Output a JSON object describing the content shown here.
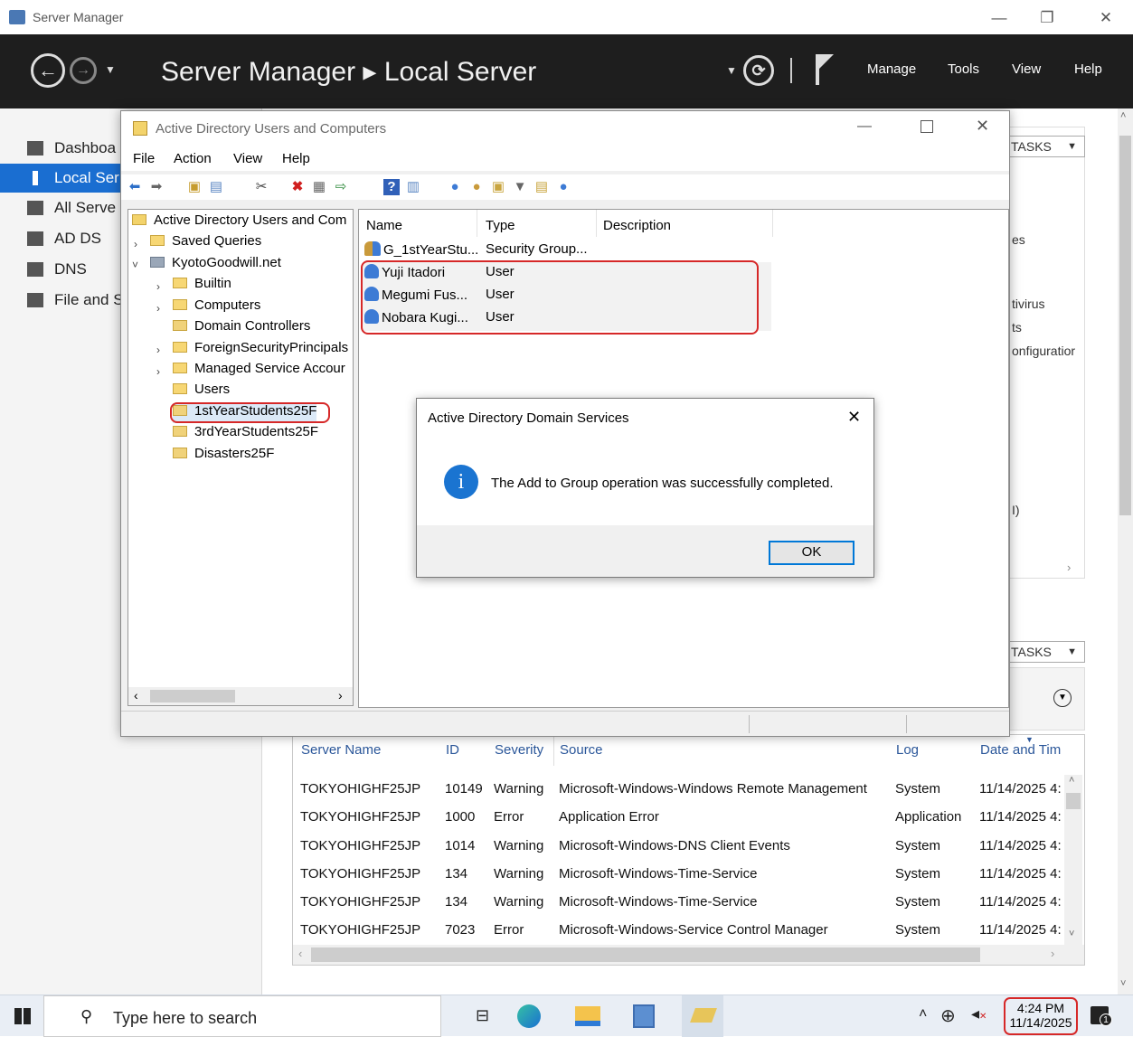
{
  "server_manager": {
    "window_title": "Server Manager",
    "breadcrumb": "Server Manager  ▸  Local Server",
    "menu": [
      "Manage",
      "Tools",
      "View",
      "Help"
    ],
    "nav": [
      {
        "label": "Dashboa",
        "selected": false
      },
      {
        "label": "Local Ser",
        "selected": true
      },
      {
        "label": "All Serve",
        "selected": false
      },
      {
        "label": "AD DS",
        "selected": false
      },
      {
        "label": "DNS",
        "selected": false
      },
      {
        "label": "File and S",
        "selected": false
      }
    ],
    "tasks_label": "TASKS",
    "side_fragments": [
      "es",
      "tivirus",
      "ts",
      "onfiguratior",
      "I)"
    ]
  },
  "events": {
    "columns": [
      "Server Name",
      "ID",
      "Severity",
      "Source",
      "Log",
      "Date and Tim"
    ],
    "rows": [
      [
        "TOKYOHIGHF25JP",
        "10149",
        "Warning",
        "Microsoft-Windows-Windows Remote Management",
        "System",
        "11/14/2025 4:"
      ],
      [
        "TOKYOHIGHF25JP",
        "1000",
        "Error",
        "Application Error",
        "Application",
        "11/14/2025 4:"
      ],
      [
        "TOKYOHIGHF25JP",
        "1014",
        "Warning",
        "Microsoft-Windows-DNS Client Events",
        "System",
        "11/14/2025 4:"
      ],
      [
        "TOKYOHIGHF25JP",
        "134",
        "Warning",
        "Microsoft-Windows-Time-Service",
        "System",
        "11/14/2025 4:"
      ],
      [
        "TOKYOHIGHF25JP",
        "134",
        "Warning",
        "Microsoft-Windows-Time-Service",
        "System",
        "11/14/2025 4:"
      ],
      [
        "TOKYOHIGHF25JP",
        "7023",
        "Error",
        "Microsoft-Windows-Service Control Manager",
        "System",
        "11/14/2025 4:"
      ]
    ]
  },
  "aduc": {
    "title": "Active Directory Users and Computers",
    "menu": [
      "File",
      "Action",
      "View",
      "Help"
    ],
    "tree": {
      "root": "Active Directory Users and Com",
      "saved_queries": "Saved Queries",
      "domain": "KyotoGoodwill.net",
      "children": [
        "Builtin",
        "Computers",
        "Domain Controllers",
        "ForeignSecurityPrincipals",
        "Managed Service Accour",
        "Users",
        "1stYearStudents25F",
        "3rdYearStudents25F",
        "Disasters25F"
      ]
    },
    "list": {
      "columns": [
        "Name",
        "Type",
        "Description"
      ],
      "rows": [
        {
          "name": "G_1stYearStu...",
          "type": "Security Group...",
          "icon": "group-icon"
        },
        {
          "name": "Yuji Itadori",
          "type": "User",
          "icon": "user-icon"
        },
        {
          "name": "Megumi Fus...",
          "type": "User",
          "icon": "user-icon"
        },
        {
          "name": "Nobara Kugi...",
          "type": "User",
          "icon": "user-icon"
        }
      ]
    }
  },
  "dialog": {
    "title": "Active Directory Domain Services",
    "message": "The Add to Group operation was successfully completed.",
    "ok_label": "OK"
  },
  "taskbar": {
    "search_placeholder": "Type here to search",
    "time": "4:24 PM",
    "date": "11/14/2025",
    "notification_count": "1"
  }
}
